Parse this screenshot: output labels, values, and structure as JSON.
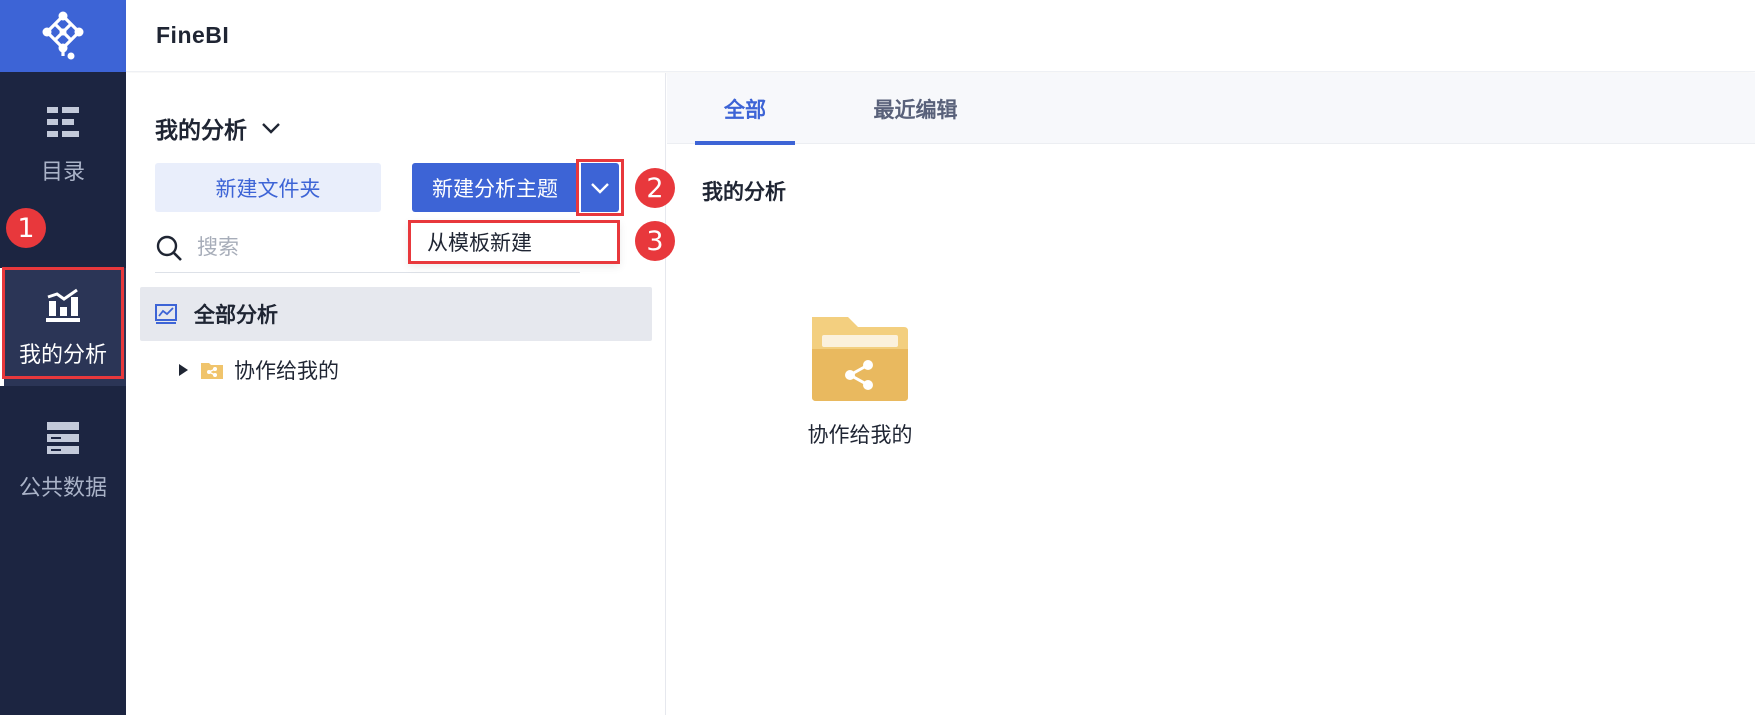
{
  "app": {
    "title": "FineBI"
  },
  "nav": {
    "items": [
      {
        "key": "catalog",
        "label": "目录",
        "icon": "list-icon"
      },
      {
        "key": "my-analysis",
        "label": "我的分析",
        "icon": "chart-icon",
        "active": true
      },
      {
        "key": "public-data",
        "label": "公共数据",
        "icon": "database-icon"
      }
    ]
  },
  "panel": {
    "title": "我的分析",
    "new_folder_label": "新建文件夹",
    "new_topic_label": "新建分析主题",
    "dropdown_item": "从模板新建",
    "search_placeholder": "搜索",
    "tree": {
      "all_label": "全部分析",
      "child_label": "协作给我的"
    }
  },
  "content": {
    "tabs": [
      {
        "label": "全部",
        "active": true
      },
      {
        "label": "最近编辑",
        "active": false
      }
    ],
    "section_title": "我的分析",
    "tiles": [
      {
        "label": "协作给我的",
        "icon": "shared-folder-icon"
      }
    ]
  },
  "markers": [
    "1",
    "2",
    "3"
  ],
  "colors": {
    "nav_bg": "#1c2541",
    "accent": "#3d64d6",
    "highlight": "#e8383c",
    "folder": "#f0c46c"
  }
}
